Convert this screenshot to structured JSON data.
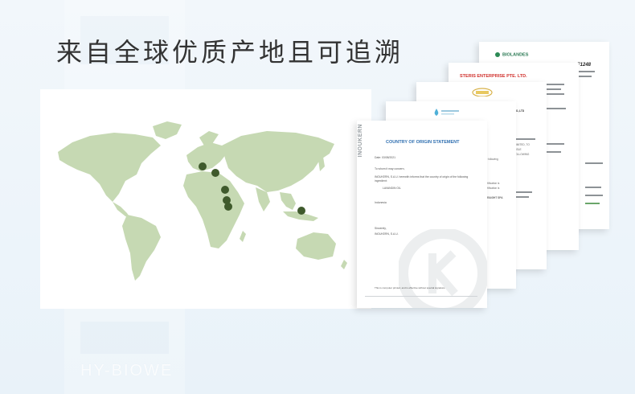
{
  "headline": "来自全球优质产地且可追溯",
  "watermark": "HY-BIOWE",
  "map": {
    "land_color": "#c6d9b3",
    "marker_color": "#3f5a2c",
    "marker_count": 6
  },
  "documents": {
    "d5": {
      "brand": "BIOLANDES",
      "code": "F1248"
    },
    "d4": {
      "brand": "STERIS ENTERPRISE PTE. LTD.",
      "fragment": "RCE CO.,LTD"
    },
    "d3": {
      "fragments": [
        "FINE LIMITED, TO",
        "YALE, ISLE",
        "THE FOLLOWING"
      ]
    },
    "d2": {
      "fragments": [
        "the following",
        "certification is",
        "STRAIGHT SPA"
      ]
    },
    "d1": {
      "side_brand": "INOUKERN",
      "title": "COUNTRY OF ORIGIN STATEMENT",
      "date": "Date: 03/08/2021",
      "salutation": "To whom it may concern,",
      "body": "INOUKERN, S.A.U. herewith informs that the country of origin of the following ingredient:",
      "ingredient": "LAVANDIN OIL",
      "origin": "Indonesia",
      "closing": "Sincerely,",
      "signature": "INOUKERN, S.A.U.",
      "footer": "This is computer printed, and is effective without special signature."
    }
  }
}
